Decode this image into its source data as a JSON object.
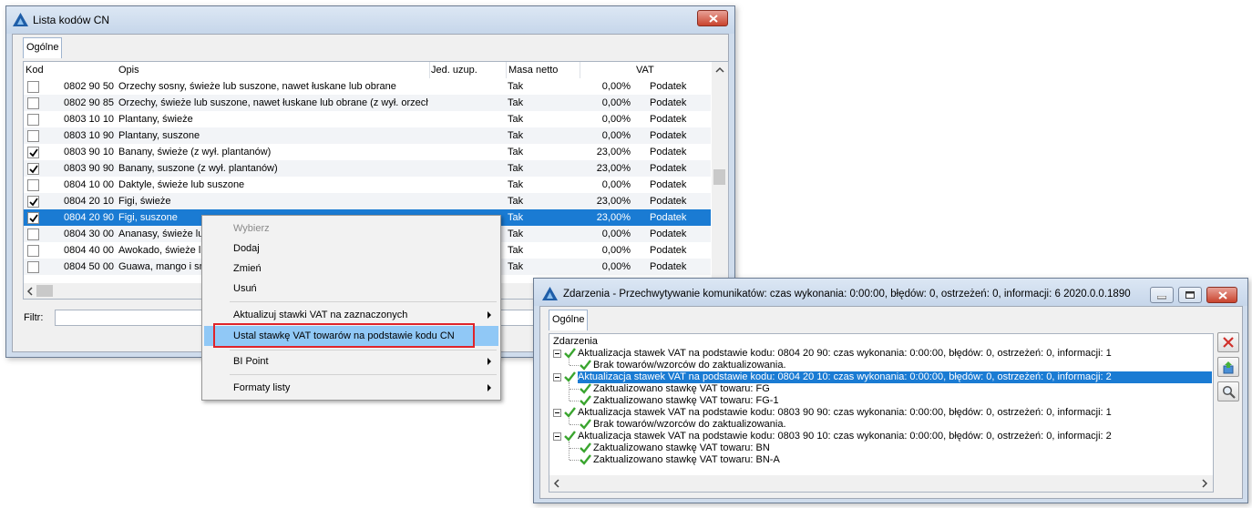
{
  "cn_window": {
    "title": "Lista kodów CN",
    "tab": "Ogólne",
    "columns": [
      "Kod",
      "Opis",
      "Jed. uzup.",
      "Masa netto",
      "VAT"
    ],
    "rows": [
      {
        "checked": false,
        "code": "0802 90 50",
        "desc": "Orzechy sosny, świeże lub suszone, nawet łuskane lub obrane",
        "masa": "Tak",
        "vat": "0,00%",
        "type": "Podatek"
      },
      {
        "checked": false,
        "code": "0802 90 85",
        "desc": "Orzechy, świeże lub suszone, nawet łuskane lub obrane (z wył. orzech",
        "masa": "Tak",
        "vat": "0,00%",
        "type": "Podatek"
      },
      {
        "checked": false,
        "code": "0803 10 10",
        "desc": "Plantany, świeże",
        "masa": "Tak",
        "vat": "0,00%",
        "type": "Podatek"
      },
      {
        "checked": false,
        "code": "0803 10 90",
        "desc": "Plantany, suszone",
        "masa": "Tak",
        "vat": "0,00%",
        "type": "Podatek"
      },
      {
        "checked": true,
        "code": "0803 90 10",
        "desc": "Banany, świeże (z wył. plantanów)",
        "masa": "Tak",
        "vat": "23,00%",
        "type": "Podatek"
      },
      {
        "checked": true,
        "code": "0803 90 90",
        "desc": "Banany, suszone (z wył. plantanów)",
        "masa": "Tak",
        "vat": "23,00%",
        "type": "Podatek"
      },
      {
        "checked": false,
        "code": "0804 10 00",
        "desc": "Daktyle, świeże lub suszone",
        "masa": "Tak",
        "vat": "0,00%",
        "type": "Podatek"
      },
      {
        "checked": true,
        "code": "0804 20 10",
        "desc": "Figi, świeże",
        "masa": "Tak",
        "vat": "23,00%",
        "type": "Podatek"
      },
      {
        "checked": true,
        "code": "0804 20 90",
        "desc": "Figi, suszone",
        "masa": "Tak",
        "vat": "23,00%",
        "type": "Podatek"
      },
      {
        "checked": false,
        "code": "0804 30 00",
        "desc": "Ananasy, świeże lu",
        "masa": "Tak",
        "vat": "0,00%",
        "type": "Podatek"
      },
      {
        "checked": false,
        "code": "0804 40 00",
        "desc": "Awokado, świeże l",
        "masa": "Tak",
        "vat": "0,00%",
        "type": "Podatek"
      },
      {
        "checked": false,
        "code": "0804 50 00",
        "desc": "Guawa, mango i sm",
        "masa": "Tak",
        "vat": "0,00%",
        "type": "Podatek"
      }
    ],
    "selected_row": 8,
    "filter_label": "Filtr:",
    "filter_value": ""
  },
  "context_menu": {
    "items": [
      "Wybierz",
      "Dodaj",
      "Zmień",
      "Usuń",
      "Aktualizuj stawki VAT na zaznaczonych",
      "Ustal stawkę VAT towarów na podstawie kodu CN",
      "BI Point",
      "Formaty listy"
    ]
  },
  "events_window": {
    "title": "Zdarzenia - Przechwytywanie komunikatów: czas wykonania: 0:00:00, błędów: 0, ostrzeżeń: 0, informacji: 6 2020.0.0.1890",
    "tab": "Ogólne",
    "root": "Zdarzenia",
    "groups": [
      {
        "label": "Aktualizacja stawek VAT na podstawie kodu: 0804 20 90: czas wykonania:  0:00:00, błędów: 0, ostrzeżeń: 0, informacji: 1",
        "children": [
          "Brak towarów/wzorców do zaktualizowania."
        ]
      },
      {
        "label": "Aktualizacja stawek VAT na podstawie kodu: 0804 20 10: czas wykonania:  0:00:00, błędów: 0, ostrzeżeń: 0, informacji: 2",
        "children": [
          "Zaktualizowano stawkę VAT towaru: FG",
          "Zaktualizowano stawkę VAT towaru: FG-1"
        ]
      },
      {
        "label": "Aktualizacja stawek VAT na podstawie kodu: 0803 90 90: czas wykonania:  0:00:00, błędów: 0, ostrzeżeń: 0, informacji: 1",
        "children": [
          "Brak towarów/wzorców do zaktualizowania."
        ]
      },
      {
        "label": "Aktualizacja stawek VAT na podstawie kodu: 0803 90 10: czas wykonania:  0:00:00, błędów: 0, ostrzeżeń: 0, informacji: 2",
        "children": [
          "Zaktualizowano stawkę VAT towaru: BN",
          "Zaktualizowano stawkę VAT towaru: BN-A"
        ]
      }
    ],
    "selected_group": 1
  },
  "colors": {
    "selection": "#1a7bd3",
    "menu_highlight": "#90c8f6",
    "red_box": "#e0242a",
    "check_green": "#3aa52f"
  },
  "icons": [
    "app-logo-icon",
    "close-icon",
    "minimize-icon",
    "maximize-icon",
    "delete-icon",
    "export-icon",
    "search-icon",
    "checkmark-icon",
    "submenu-arrow-icon",
    "scroll-up-icon",
    "scroll-left-icon",
    "scroll-right-icon"
  ]
}
